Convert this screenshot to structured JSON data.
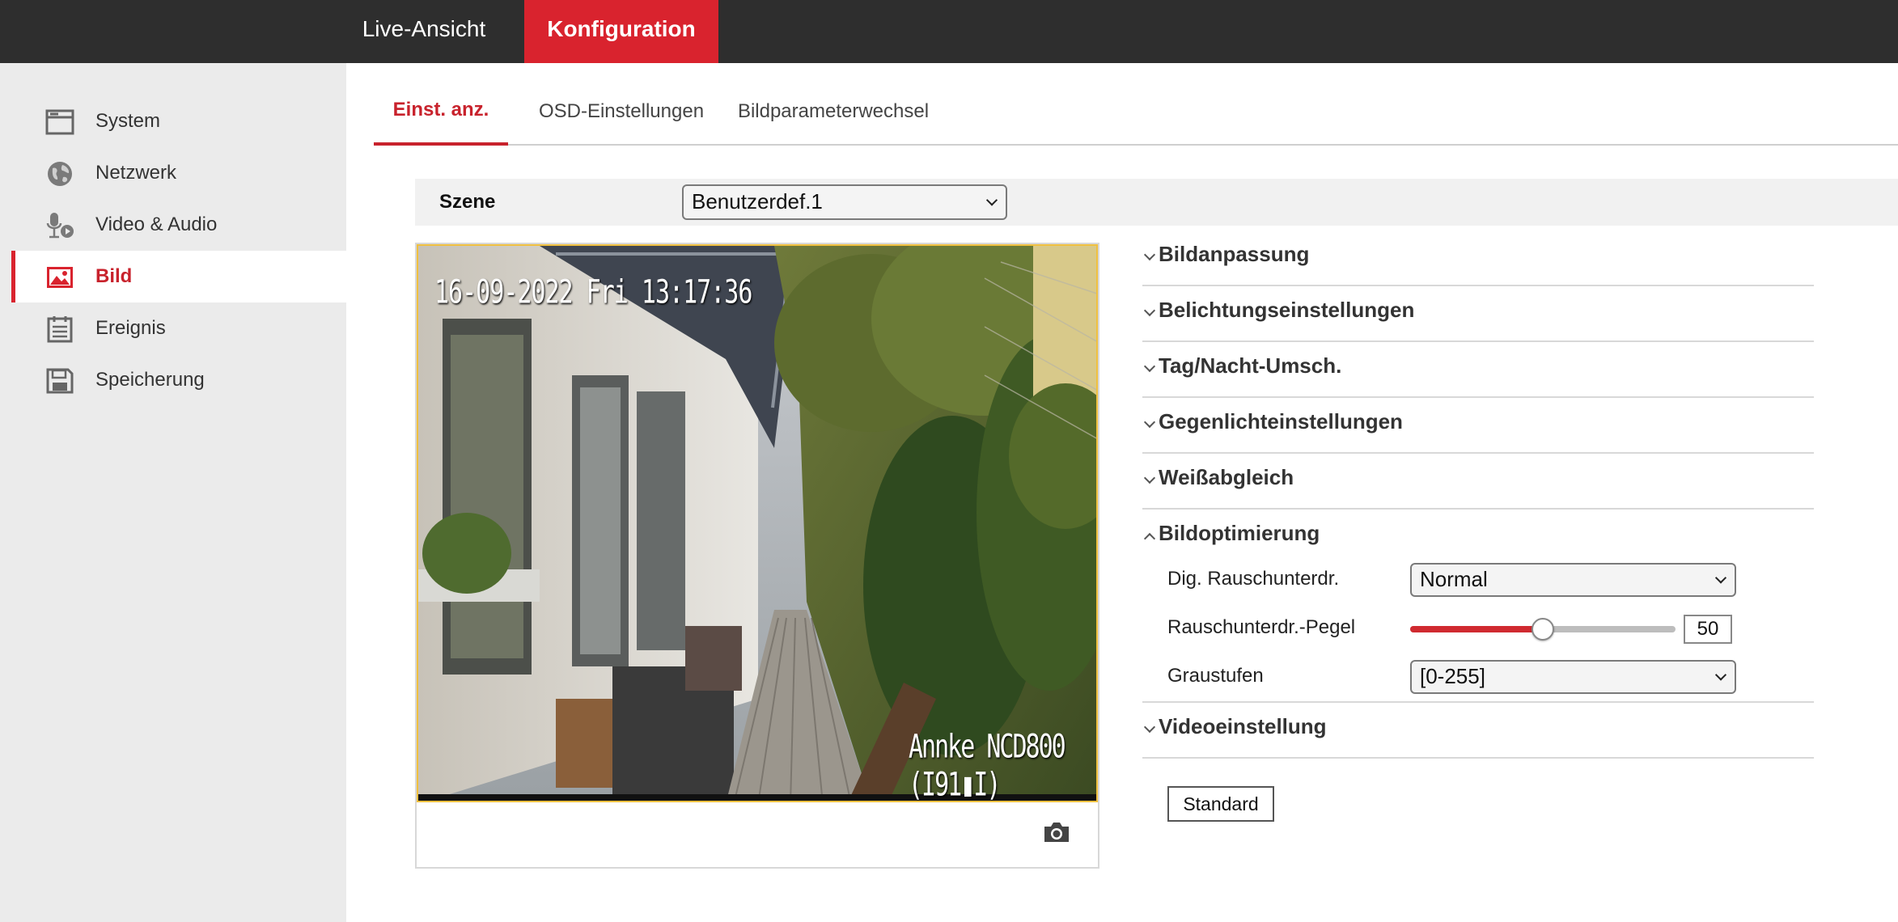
{
  "topnav": {
    "live_label": "Live-Ansicht",
    "config_label": "Konfiguration"
  },
  "colors": {
    "brand_red": "#d9232e",
    "topbar_bg": "#2e2e2e",
    "sidebar_bg": "#ebebeb"
  },
  "sidebar": {
    "items": [
      {
        "label": "System",
        "icon": "window-icon"
      },
      {
        "label": "Netzwerk",
        "icon": "globe-icon"
      },
      {
        "label": "Video & Audio",
        "icon": "microphone-icon"
      },
      {
        "label": "Bild",
        "icon": "image-icon",
        "active": true
      },
      {
        "label": "Ereignis",
        "icon": "calendar-icon"
      },
      {
        "label": "Speicherung",
        "icon": "disk-icon"
      }
    ]
  },
  "tabs": [
    {
      "label": "Einst. anz.",
      "active": true
    },
    {
      "label": "OSD-Einstellungen"
    },
    {
      "label": "Bildparameterwechsel"
    }
  ],
  "scene": {
    "label": "Szene",
    "value": "Benutzerdef.1"
  },
  "preview": {
    "osd_date": "16-09-2022 Fri 13:17:36",
    "osd_name": "Annke NCD800 (I91▮I)",
    "snapshot_icon": "camera-icon"
  },
  "sections": [
    {
      "title": "Bildanpassung",
      "expanded": false
    },
    {
      "title": "Belichtungseinstellungen",
      "expanded": false
    },
    {
      "title": "Tag/Nacht-Umsch.",
      "expanded": false
    },
    {
      "title": "Gegenlichteinstellungen",
      "expanded": false
    },
    {
      "title": "Weißabgleich",
      "expanded": false
    },
    {
      "title": "Bildoptimierung",
      "expanded": true
    },
    {
      "title": "Videoeinstellung",
      "expanded": false
    }
  ],
  "bildoptimierung": {
    "noise_reduction_label": "Dig. Rauschunterdr.",
    "noise_reduction_value": "Normal",
    "noise_level_label": "Rauschunterdr.-Pegel",
    "noise_level_value": "50",
    "noise_level_fraction": 0.5,
    "grayscale_label": "Graustufen",
    "grayscale_value": "[0-255]"
  },
  "buttons": {
    "default_label": "Standard"
  }
}
